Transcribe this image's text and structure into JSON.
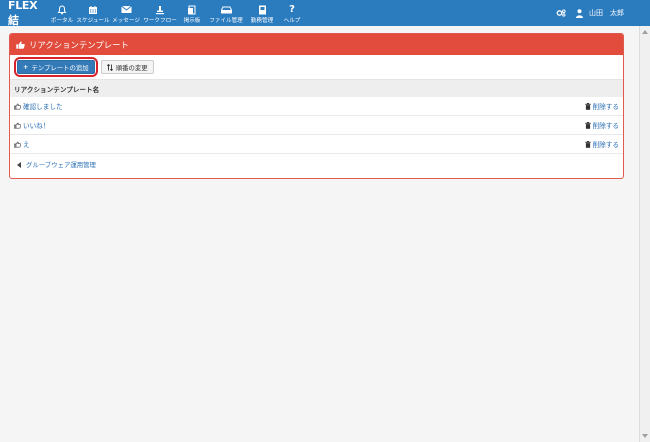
{
  "header": {
    "brand": "FLEX結",
    "nav": [
      {
        "icon": "bell-icon",
        "label": "ポータル"
      },
      {
        "icon": "calendar-icon",
        "label": "スケジュール"
      },
      {
        "icon": "envelope-icon",
        "label": "メッセージ"
      },
      {
        "icon": "workflow-icon",
        "label": "ワークフロー"
      },
      {
        "icon": "board-icon",
        "label": "掲示板"
      },
      {
        "icon": "drive-icon",
        "label": "ファイル管理"
      },
      {
        "icon": "document-icon",
        "label": "勤務管理"
      },
      {
        "icon": "question-icon",
        "label": "ヘルプ"
      }
    ],
    "user_name": "山田　太郎"
  },
  "panel": {
    "title": "リアクションテンプレート",
    "add_button": "テンプレートの追加",
    "order_button": "順番の変更",
    "column_header": "リアクションテンプレート名",
    "rows": [
      {
        "name": "確認しました",
        "delete": "削除する"
      },
      {
        "name": "いいね！",
        "delete": "削除する"
      },
      {
        "name": "え",
        "delete": "削除する"
      }
    ],
    "back_link": "グループウェア運用管理"
  }
}
